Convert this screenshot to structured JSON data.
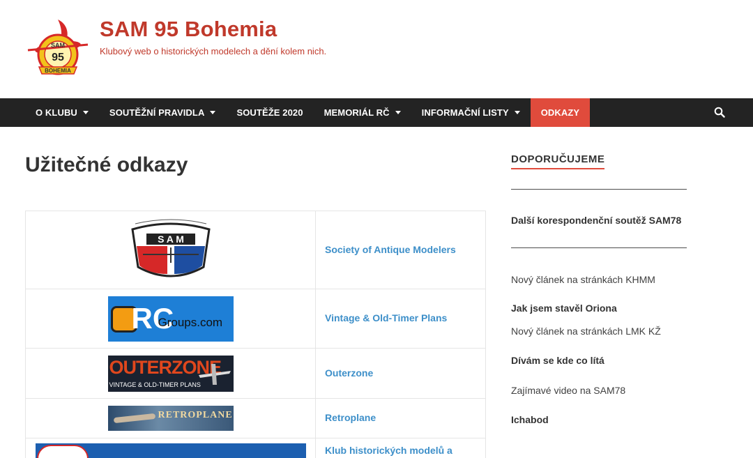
{
  "header": {
    "title": "SAM 95 Bohemia",
    "description": "Klubový web o historických modelech a dění kolem nich.",
    "logo": {
      "top_text": "SAM",
      "number": "95",
      "bottom_text": "BOHEMIA"
    }
  },
  "nav": {
    "items": [
      {
        "label": "O klubu",
        "has_dropdown": true
      },
      {
        "label": "Soutěžní pravidla",
        "has_dropdown": true
      },
      {
        "label": "Soutěže 2020",
        "has_dropdown": false
      },
      {
        "label": "Memoriál RČ",
        "has_dropdown": true
      },
      {
        "label": "Informační listy",
        "has_dropdown": true
      },
      {
        "label": "Odkazy",
        "has_dropdown": false,
        "active": true
      }
    ],
    "search_icon": "search-icon"
  },
  "main": {
    "title": "Užitečné odkazy",
    "links": [
      {
        "label": "Society of Antique Modelers",
        "banner": "sam-society-logo"
      },
      {
        "label": "Vintage & Old-Timer Plans",
        "banner": "rcgroups-banner",
        "banner_text": "Groups.com"
      },
      {
        "label": "Outerzone",
        "banner": "outerzone-banner",
        "banner_text": "OUTERZONE",
        "banner_sub": "VINTAGE & OLD-TIMER PLANS"
      },
      {
        "label": "Retroplane",
        "banner": "retroplane-banner",
        "banner_text": "RETROPLANE"
      },
      {
        "label": "Klub historických modelů a",
        "banner": "khmm-banner"
      }
    ]
  },
  "sidebar": {
    "title": "Doporučujeme",
    "items": [
      {
        "text": "——————————————————",
        "bold": false
      },
      {
        "text": "Další korespondenční soutěž SAM78",
        "bold": true
      },
      {
        "text": "——————————————————",
        "bold": false
      },
      {
        "text": "Nový článek na stránkách KHMM",
        "bold": false
      },
      {
        "text": "Jak jsem stavěl Oriona",
        "bold": true
      },
      {
        "text": "Nový článek na stránkách LMK KŽ",
        "bold": false
      },
      {
        "text": "Dívám se kde co lítá",
        "bold": true
      },
      {
        "text": "Zajímavé video na SAM78",
        "bold": false
      },
      {
        "text": "Ichabod",
        "bold": true
      }
    ]
  },
  "colors": {
    "accent": "#e04b3c",
    "brand": "#c0392b",
    "nav_bg": "#232323",
    "link": "#3d8fc9"
  }
}
